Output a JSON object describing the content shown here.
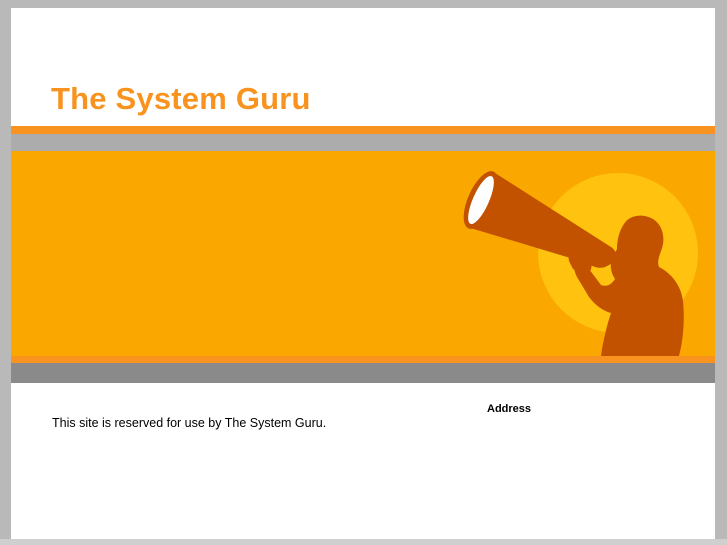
{
  "header": {
    "title": "The System Guru"
  },
  "hero": {
    "image_subject": "megaphone-person-icon"
  },
  "main": {
    "intro_text": "This site is reserved for use by The System Guru.",
    "address_heading": "Address"
  },
  "colors": {
    "accent_orange": "#f7931e",
    "hero_background": "#faa800",
    "sun_yellow": "#ffc20e",
    "silhouette_brown": "#c25200",
    "gray_band": "#acacac",
    "dark_gray_band": "#8a8a8a",
    "page_background": "#b9b9b9"
  }
}
